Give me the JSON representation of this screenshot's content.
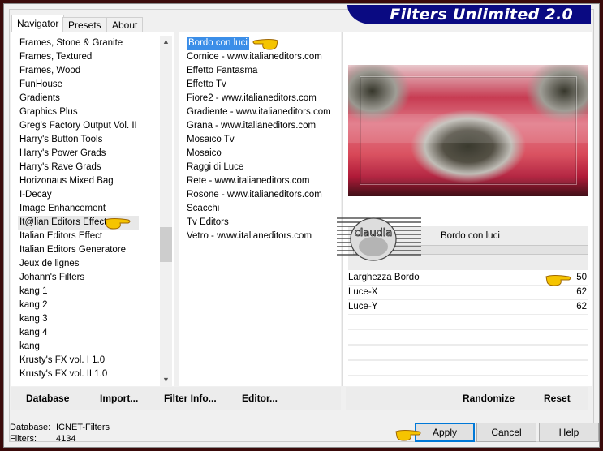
{
  "app": {
    "title": "Filters Unlimited 2.0"
  },
  "tabs": [
    {
      "label": "Navigator",
      "active": true
    },
    {
      "label": "Presets",
      "active": false
    },
    {
      "label": "About",
      "active": false
    }
  ],
  "categories": {
    "items": [
      "Frames, Stone & Granite",
      "Frames, Textured",
      "Frames, Wood",
      "FunHouse",
      "Gradients",
      "Graphics Plus",
      "Greg's Factory Output Vol. II",
      "Harry's Button Tools",
      "Harry's Power Grads",
      "Harry's Rave Grads",
      "Horizonaus Mixed Bag",
      "I-Decay",
      "Image Enhancement",
      "It@lian Editors Effect",
      "Italian Editors Effect",
      "Italian Editors Generatore",
      "Jeux de lignes",
      "Johann's Filters",
      "kang 1",
      "kang 2",
      "kang 3",
      "kang 4",
      "kang",
      "Krusty's FX vol. I 1.0",
      "Krusty's FX vol. II 1.0"
    ],
    "selected": "It@lian Editors Effect",
    "scroll_up_icon": "▲",
    "scroll_down_icon": "▼"
  },
  "filters": {
    "items": [
      "Bordo con luci",
      "Cornice - www.italianeditors.com",
      "Effetto Fantasma",
      "Effetto Tv",
      "Fiore2 - www.italianeditors.com",
      "Gradiente - www.italianeditors.com",
      "Grana - www.italianeditors.com",
      "Mosaico Tv",
      "Mosaico",
      "Raggi di Luce",
      "Rete - www.italianeditors.com",
      "Rosone - www.italianeditors.com",
      "Scacchi",
      "Tv Editors",
      "Vetro - www.italianeditors.com"
    ],
    "selected": "Bordo con luci"
  },
  "preview": {
    "filter_name": "Bordo con luci",
    "watermark": "claudia"
  },
  "params": [
    {
      "label": "Larghezza Bordo",
      "value": "50"
    },
    {
      "label": "Luce-X",
      "value": "62"
    },
    {
      "label": "Luce-Y",
      "value": "62"
    }
  ],
  "left_buttons": {
    "database": "Database",
    "import": "Import...",
    "filter_info": "Filter Info...",
    "editor": "Editor..."
  },
  "right_buttons": {
    "randomize": "Randomize",
    "reset": "Reset"
  },
  "status": {
    "database_label": "Database:",
    "database_value": "ICNET-Filters",
    "filters_label": "Filters:",
    "filters_value": "4134"
  },
  "dialog_buttons": {
    "apply": "Apply",
    "cancel": "Cancel",
    "help": "Help"
  },
  "colors": {
    "banner": "#0a0a82",
    "selection": "#3b8ee8",
    "default_button_border": "#0078d7",
    "outer_border": "#3a0a0a",
    "pointer_hand": "#f5c400"
  }
}
